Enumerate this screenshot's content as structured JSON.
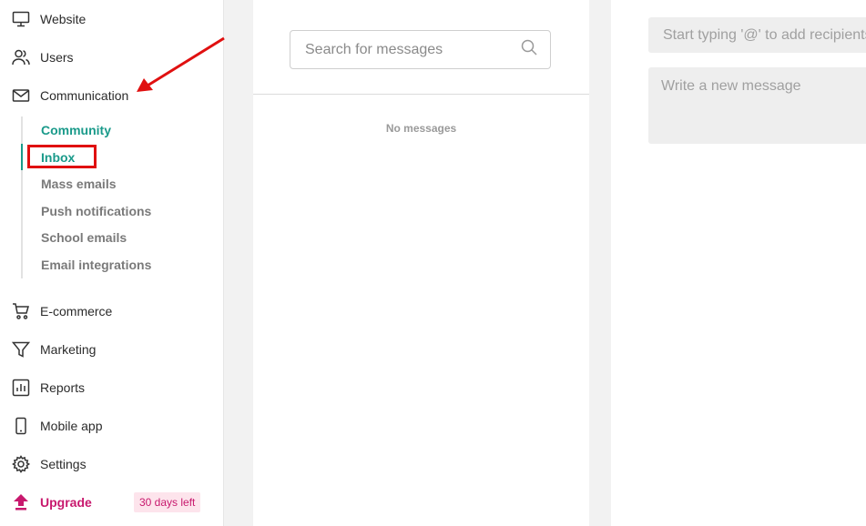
{
  "sidebar": {
    "items": [
      {
        "label": "Website",
        "icon": "monitor-icon"
      },
      {
        "label": "Users",
        "icon": "users-icon"
      },
      {
        "label": "Communication",
        "icon": "mail-icon"
      },
      {
        "label": "E-commerce",
        "icon": "cart-icon"
      },
      {
        "label": "Marketing",
        "icon": "filter-icon"
      },
      {
        "label": "Reports",
        "icon": "chart-icon"
      },
      {
        "label": "Mobile app",
        "icon": "phone-icon"
      },
      {
        "label": "Settings",
        "icon": "gear-icon"
      },
      {
        "label": "Upgrade",
        "icon": "upgrade-icon"
      }
    ],
    "communication_sub": [
      {
        "label": "Community"
      },
      {
        "label": "Inbox"
      },
      {
        "label": "Mass emails"
      },
      {
        "label": "Push notifications"
      },
      {
        "label": "School emails"
      },
      {
        "label": "Email integrations"
      }
    ],
    "upgrade_badge": "30 days left"
  },
  "inbox": {
    "search_placeholder": "Search for messages",
    "empty_text": "No messages"
  },
  "compose": {
    "recipient_placeholder": "Start typing '@' to add recipients",
    "message_placeholder": "Write a new message"
  },
  "colors": {
    "accent": "#1a9a8a",
    "upgrade": "#c8196e",
    "annotation": "#e01010"
  }
}
